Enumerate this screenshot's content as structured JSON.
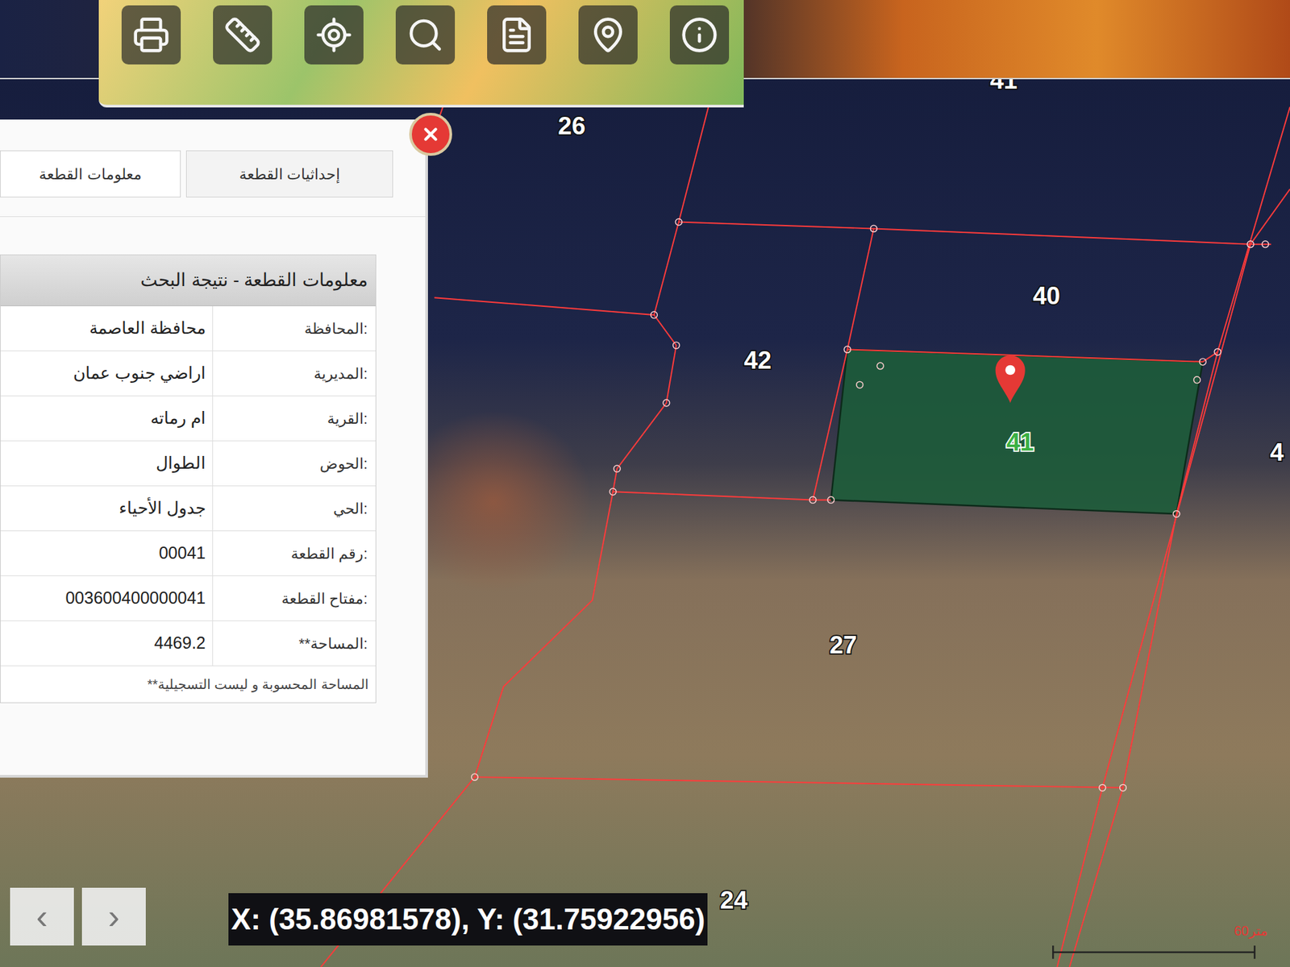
{
  "panel": {
    "tabs": [
      {
        "label": "إحداثيات القطعة",
        "selected": false
      },
      {
        "label": "معلومات القطعة",
        "selected": true
      }
    ],
    "table": {
      "title": "معلومات القطعة - نتيجة البحث",
      "rows": [
        {
          "label": "المحافظة:",
          "value": "محافظة العاصمة"
        },
        {
          "label": "المديرية:",
          "value": "اراضي جنوب عمان"
        },
        {
          "label": "القرية:",
          "value": "ام رماته"
        },
        {
          "label": "الحوض:",
          "value": "الطوال"
        },
        {
          "label": "الحي:",
          "value": "جدول الأحياء"
        },
        {
          "label": "رقم القطعة:",
          "value": "00041"
        },
        {
          "label": "مفتاح القطعة:",
          "value": "003600400000041"
        },
        {
          "label": "**المساحة:",
          "value": "4469.2"
        }
      ],
      "note": "**المساحة المحسوبة و ليست التسجيلية"
    }
  },
  "map": {
    "parcels": [
      {
        "label": "41",
        "selected": false
      },
      {
        "label": "26",
        "selected": false
      },
      {
        "label": "40",
        "selected": false
      },
      {
        "label": "42",
        "selected": false
      },
      {
        "label": "41",
        "selected": true
      },
      {
        "label": "27",
        "selected": false
      },
      {
        "label": "24",
        "selected": false
      },
      {
        "label": "4",
        "selected": false
      }
    ],
    "coordinates": "X: (35.86981578), Y: (31.75922956)",
    "scale": "60متر"
  },
  "nav": [
    "‹",
    "›"
  ]
}
